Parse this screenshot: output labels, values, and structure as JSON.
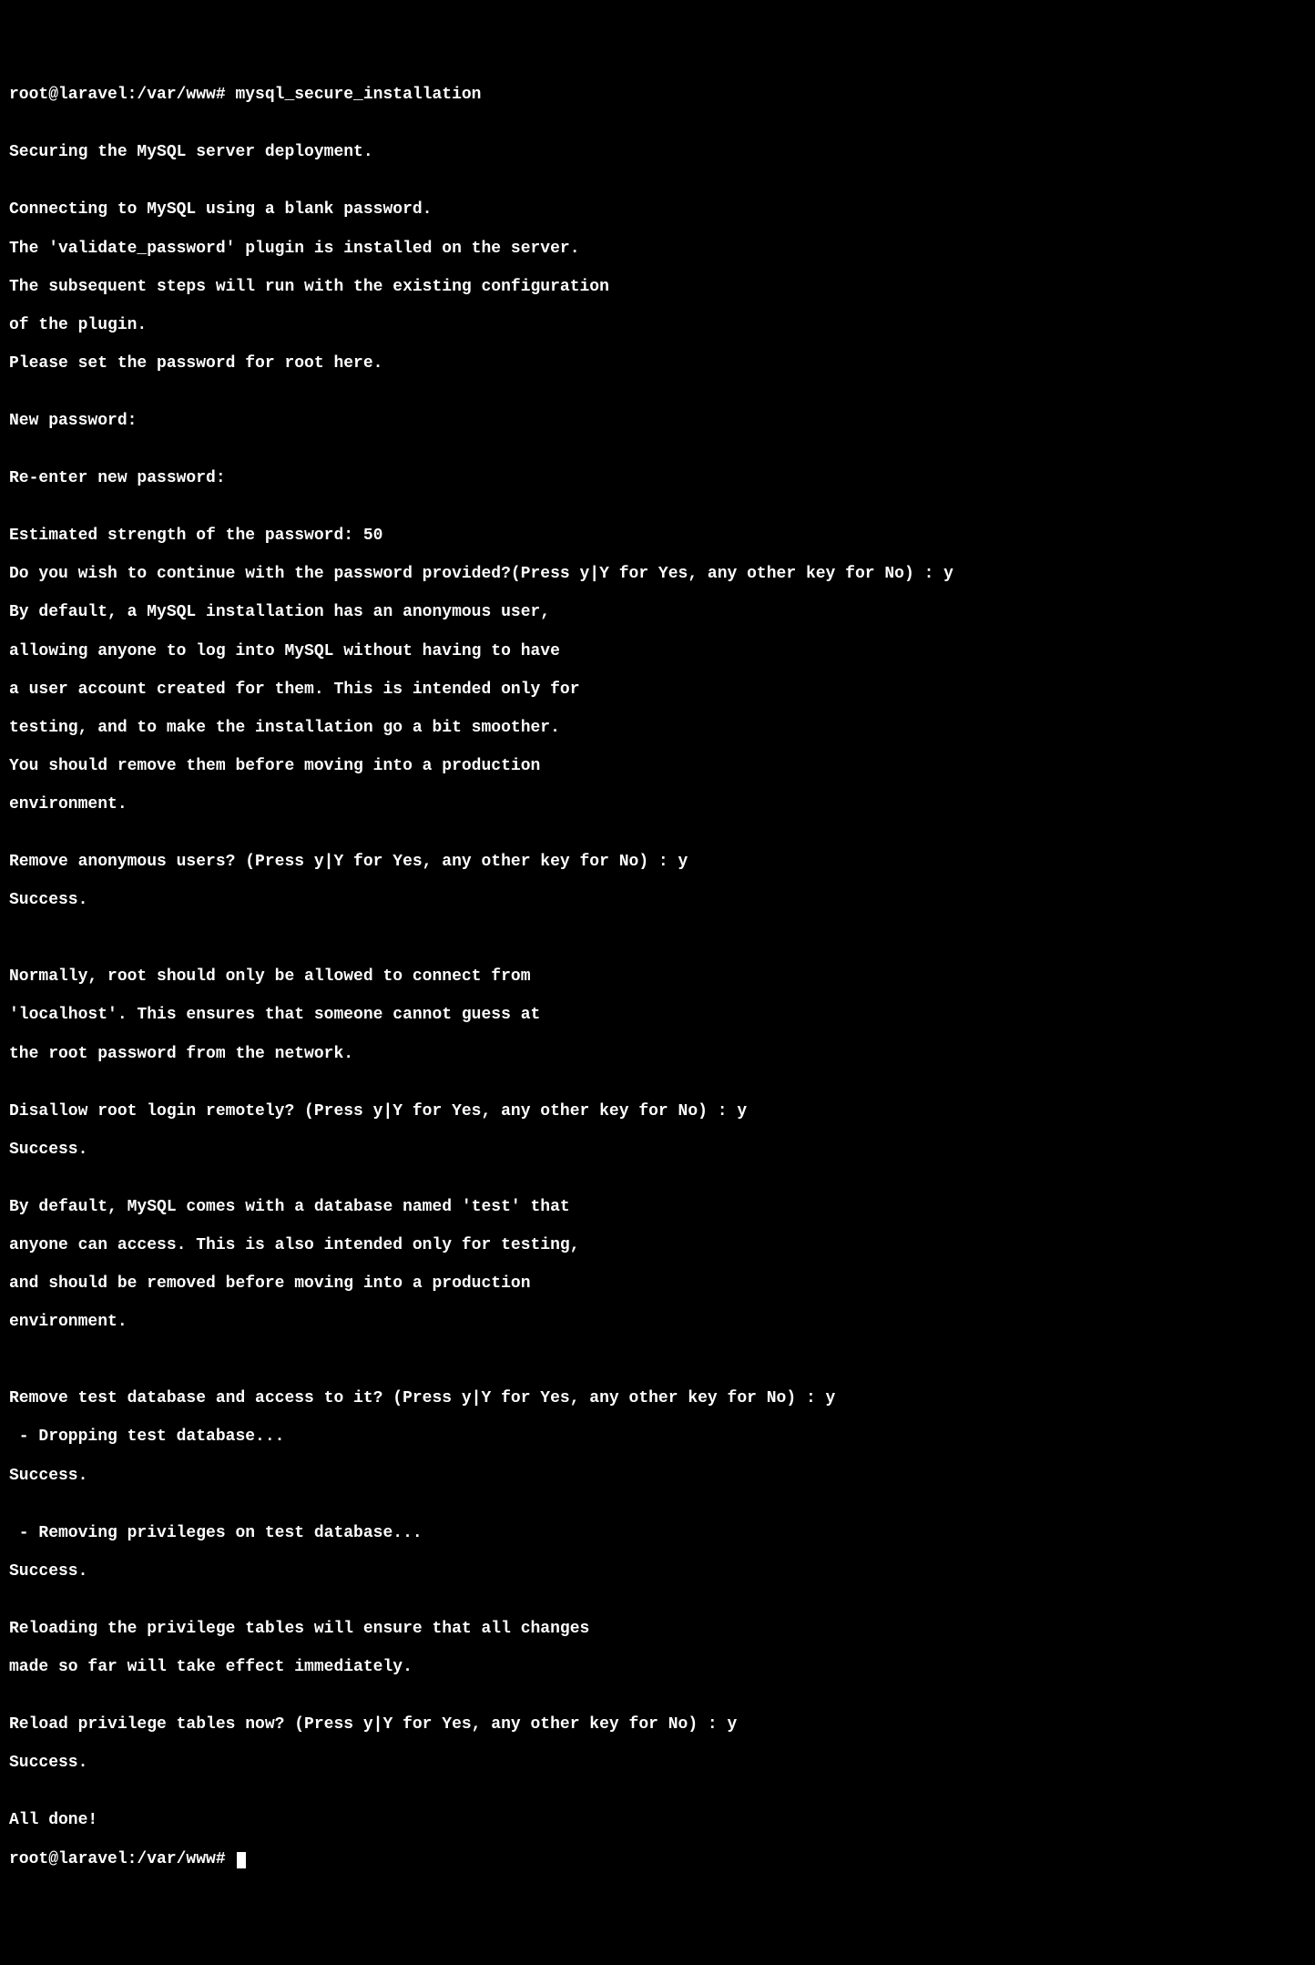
{
  "lines": {
    "l0": "root@laravel:/var/www# mysql_secure_installation",
    "l1": "",
    "l2": "Securing the MySQL server deployment.",
    "l3": "",
    "l4": "Connecting to MySQL using a blank password.",
    "l5": "The 'validate_password' plugin is installed on the server.",
    "l6": "The subsequent steps will run with the existing configuration",
    "l7": "of the plugin.",
    "l8": "Please set the password for root here.",
    "l9": "",
    "l10": "New password:",
    "l11": "",
    "l12": "Re-enter new password:",
    "l13": "",
    "l14": "Estimated strength of the password: 50",
    "l15": "Do you wish to continue with the password provided?(Press y|Y for Yes, any other key for No) : y",
    "l16": "By default, a MySQL installation has an anonymous user,",
    "l17": "allowing anyone to log into MySQL without having to have",
    "l18": "a user account created for them. This is intended only for",
    "l19": "testing, and to make the installation go a bit smoother.",
    "l20": "You should remove them before moving into a production",
    "l21": "environment.",
    "l22": "",
    "l23": "Remove anonymous users? (Press y|Y for Yes, any other key for No) : y",
    "l24": "Success.",
    "l25": "",
    "l26": "",
    "l27": "Normally, root should only be allowed to connect from",
    "l28": "'localhost'. This ensures that someone cannot guess at",
    "l29": "the root password from the network.",
    "l30": "",
    "l31": "Disallow root login remotely? (Press y|Y for Yes, any other key for No) : y",
    "l32": "Success.",
    "l33": "",
    "l34": "By default, MySQL comes with a database named 'test' that",
    "l35": "anyone can access. This is also intended only for testing,",
    "l36": "and should be removed before moving into a production",
    "l37": "environment.",
    "l38": "",
    "l39": "",
    "l40": "Remove test database and access to it? (Press y|Y for Yes, any other key for No) : y",
    "l41": " - Dropping test database...",
    "l42": "Success.",
    "l43": "",
    "l44": " - Removing privileges on test database...",
    "l45": "Success.",
    "l46": "",
    "l47": "Reloading the privilege tables will ensure that all changes",
    "l48": "made so far will take effect immediately.",
    "l49": "",
    "l50": "Reload privilege tables now? (Press y|Y for Yes, any other key for No) : y",
    "l51": "Success.",
    "l52": "",
    "l53": "All done!",
    "l54": "root@laravel:/var/www# "
  }
}
